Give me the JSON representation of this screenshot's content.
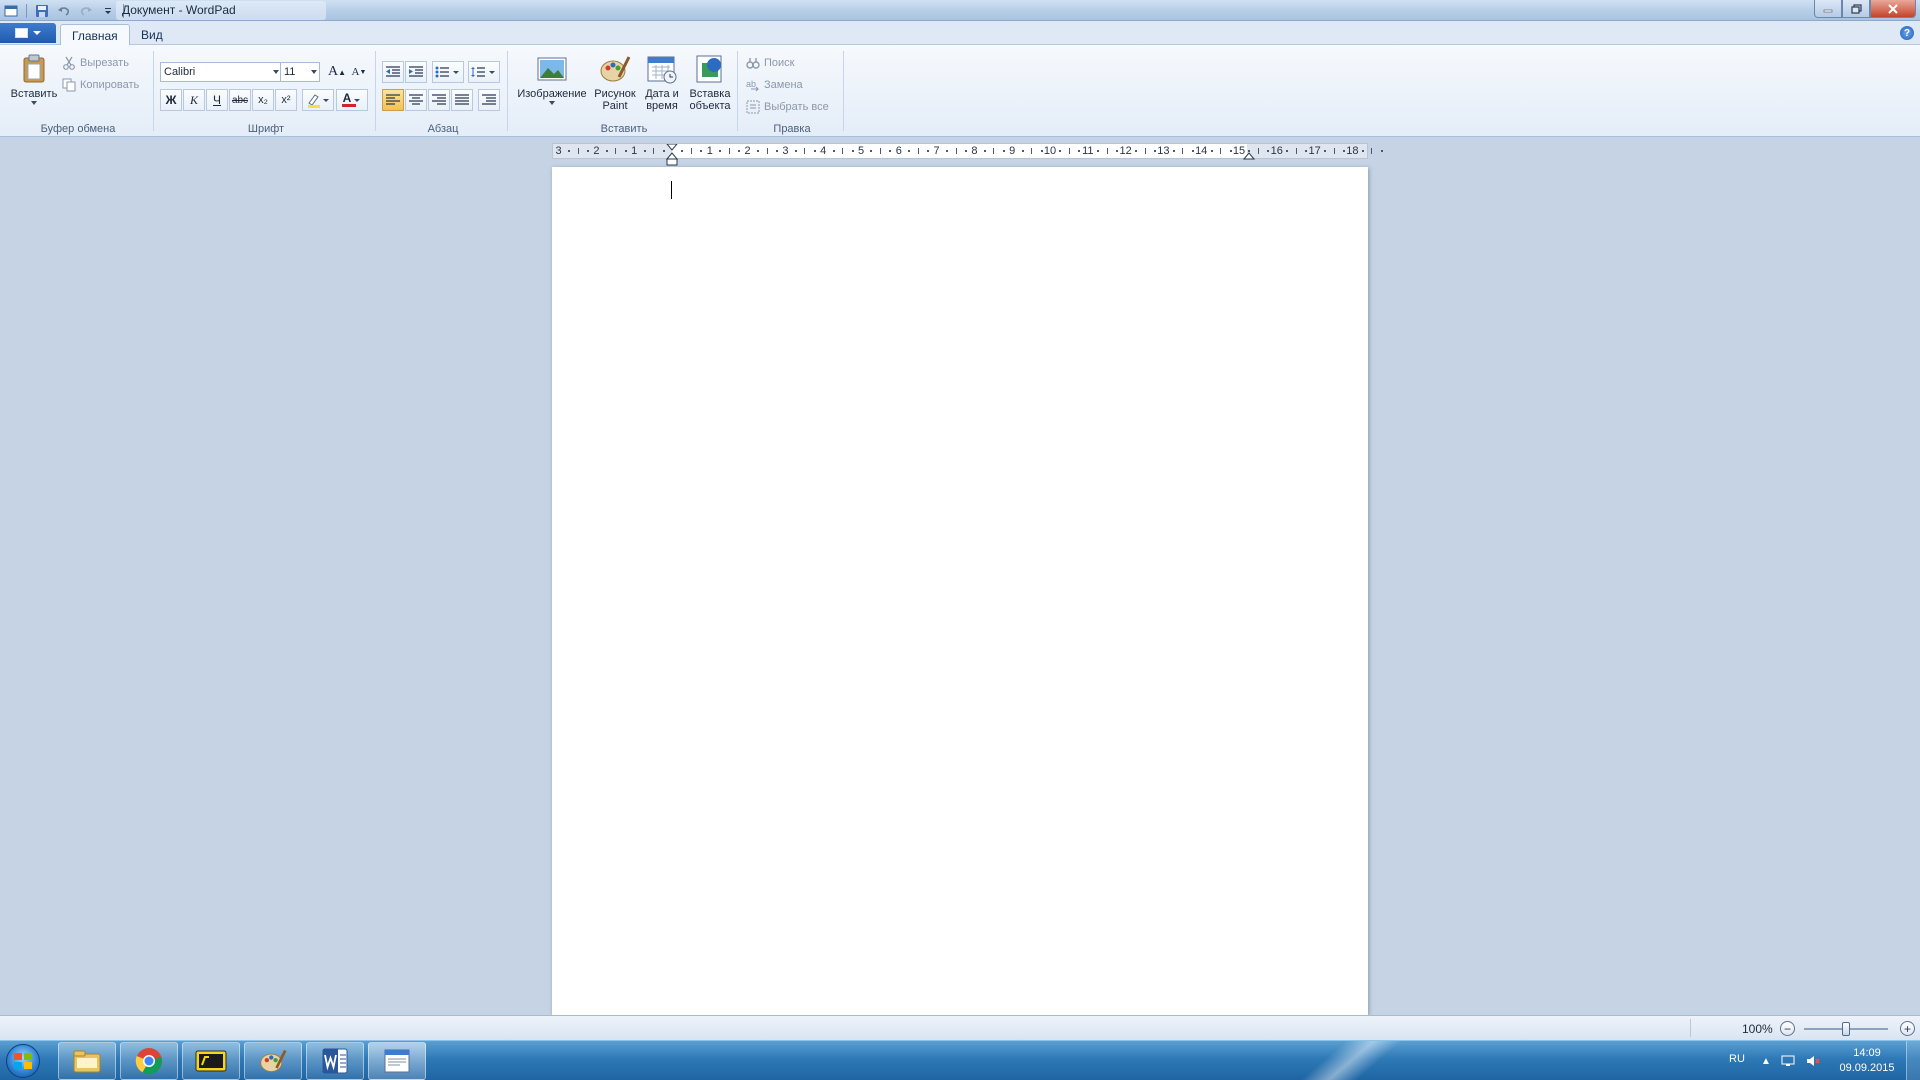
{
  "window": {
    "title": "Документ - WordPad"
  },
  "qat": {
    "icons": [
      "wordpad-icon",
      "save-icon",
      "undo-icon",
      "redo-icon",
      "customize-icon"
    ]
  },
  "tabs": [
    {
      "label": "Главная",
      "active": true
    },
    {
      "label": "Вид",
      "active": false
    }
  ],
  "ribbon": {
    "clipboard": {
      "label": "Буфер обмена",
      "paste": "Вставить",
      "cut": "Вырезать",
      "copy": "Копировать"
    },
    "font": {
      "label": "Шрифт",
      "family": "Calibri",
      "size": "11",
      "grow": "A",
      "shrink": "A",
      "bold": "Ж",
      "italic": "К",
      "underline": "Ч",
      "strike": "abc",
      "subscript": "x₂",
      "superscript": "x²",
      "color_letter": "A"
    },
    "paragraph": {
      "label": "Абзац"
    },
    "insert": {
      "label": "Вставить",
      "image": "Изображение",
      "paint_line1": "Рисунок",
      "paint_line2": "Paint",
      "datetime_line1": "Дата и",
      "datetime_line2": "время",
      "object_line1": "Вставка",
      "object_line2": "объекта"
    },
    "edit": {
      "label": "Правка",
      "find": "Поиск",
      "replace": "Замена",
      "select_all": "Выбрать все"
    }
  },
  "ruler": {
    "numbers": [
      "3",
      "2",
      "1",
      "1",
      "2",
      "3",
      "4",
      "5",
      "6",
      "7",
      "8",
      "9",
      "10",
      "11",
      "12",
      "13",
      "14",
      "15",
      "16",
      "17",
      "18"
    ]
  },
  "status": {
    "zoom": "100%",
    "zoom_out": "−",
    "zoom_in": "+",
    "zoom_fraction": 0.5
  },
  "taskbar": {
    "apps": [
      "explorer-icon",
      "chrome-icon",
      "pdf-icon",
      "paint-icon",
      "word-icon",
      "wordpad-icon"
    ],
    "lang": "RU",
    "time": "14:09",
    "date": "09.09.2015"
  },
  "colors": {
    "highlight": "#f6c14e",
    "font_color": "#d2222a",
    "taskbar": "#2e79b7"
  }
}
